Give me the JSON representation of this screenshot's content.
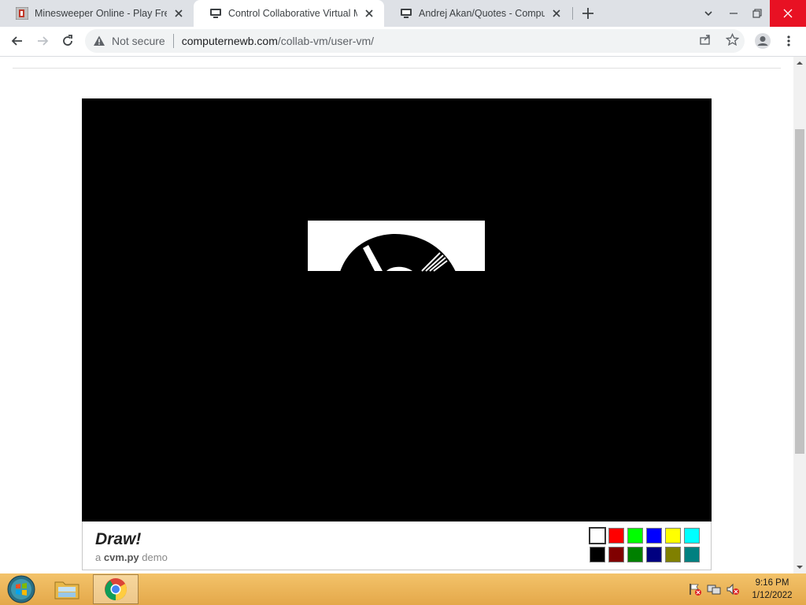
{
  "tabs": [
    {
      "title": "Minesweeper Online - Play Free Online Minesweeper",
      "active": false,
      "favicon": "minesweeper-favicon"
    },
    {
      "title": "Control Collaborative Virtual Machines",
      "active": true,
      "favicon": "computernewb-favicon"
    },
    {
      "title": "Andrej Akan/Quotes - Computernewb Wiki",
      "active": false,
      "favicon": "computernewb-favicon"
    }
  ],
  "omnibox": {
    "security_label": "Not secure",
    "domain": "computernewb.com",
    "path": "/collab-vm/user-vm/"
  },
  "vm_footer": {
    "title": "Draw!",
    "subtitle_prefix": "a",
    "subtitle_bold": "cvm.py",
    "subtitle_suffix": "demo",
    "palette": [
      "#ffffff",
      "#ff0000",
      "#00ff00",
      "#0000ff",
      "#ffff00",
      "#00ffff",
      "#000000",
      "#800000",
      "#008000",
      "#000080",
      "#808000",
      "#008080"
    ],
    "selected_color": "#ffffff"
  },
  "taskbar": {
    "time": "9:16 PM",
    "date": "1/12/2022"
  }
}
